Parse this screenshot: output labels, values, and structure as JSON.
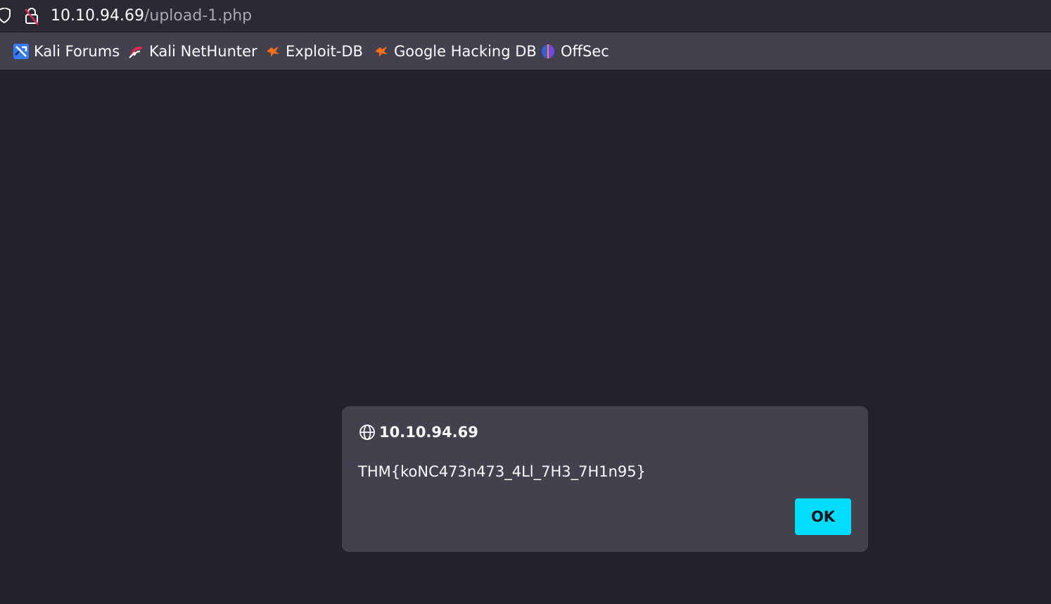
{
  "urlbar": {
    "host": "10.10.94.69",
    "path": "/upload-1.php",
    "icons": [
      "shield-icon",
      "lock-insecure-icon"
    ]
  },
  "bookmarks": [
    {
      "label": "Kali Forums",
      "icon": "kali-forums-icon"
    },
    {
      "label": "Kali NetHunter",
      "icon": "kali-nethunter-icon"
    },
    {
      "label": "Exploit-DB",
      "icon": "exploit-db-icon"
    },
    {
      "label": "Google Hacking DB",
      "icon": "google-hacking-db-icon"
    },
    {
      "label": "OffSec",
      "icon": "offsec-icon"
    }
  ],
  "dialog": {
    "title": "10.10.94.69",
    "message": "THM{koNC473n473_4Ll_7H3_7H1n95}",
    "ok_label": "OK",
    "icon": "globe-icon"
  },
  "colors": {
    "toolbar": "#2b2a33",
    "bookmarks_bar": "#42414d",
    "page_background": "#23222b",
    "dialog": "#42414d",
    "ok_button": "#00ddff"
  }
}
